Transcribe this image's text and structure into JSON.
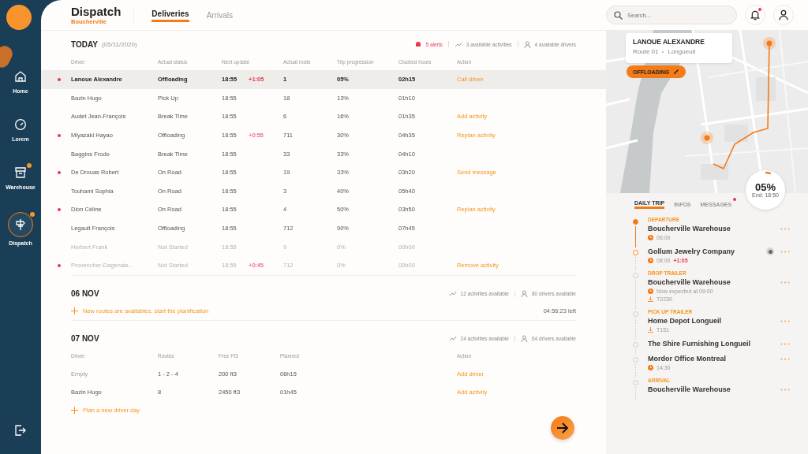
{
  "sidebar": {
    "items": [
      {
        "label": "Home",
        "selected": false,
        "badge": false
      },
      {
        "label": "Lorem",
        "selected": false,
        "badge": false
      },
      {
        "label": "Warehouse",
        "selected": false,
        "badge": true
      },
      {
        "label": "Dispatch",
        "selected": true,
        "badge": true
      }
    ]
  },
  "header": {
    "title": "Dispatch",
    "subtitle": "Boucherville",
    "tabs": [
      {
        "label": "Deliveries",
        "selected": true
      },
      {
        "label": "Arrivals",
        "selected": false
      }
    ]
  },
  "today": {
    "title": "TODAY",
    "date": "(05/11/2020)",
    "alerts": "5 alerts",
    "activities": "3 available activities",
    "drivers": "4 available drivers",
    "columns": [
      "Driver",
      "Actual status",
      "Next update",
      "Actual route",
      "Trip progression",
      "Clocked hours",
      "Action"
    ],
    "rows": [
      {
        "alert": true,
        "selected": true,
        "disabled": false,
        "driver": "Lanoue Alexandre",
        "status": "Offloading",
        "next_update": "18:55",
        "delay": "+1:05",
        "route": "1",
        "trip": "05%",
        "clocked": "02h15",
        "action": "Call driver"
      },
      {
        "alert": false,
        "selected": false,
        "disabled": false,
        "driver": "Bazin Hugo",
        "status": "Pick Up",
        "next_update": "18:55",
        "route": "18",
        "trip": "13%",
        "clocked": "01h10"
      },
      {
        "alert": false,
        "selected": false,
        "disabled": false,
        "driver": "Audet Jean-François",
        "status": "Break Time",
        "next_update": "18:55",
        "route": "6",
        "trip": "16%",
        "clocked": "01h35",
        "action": "Add activity"
      },
      {
        "alert": true,
        "selected": false,
        "disabled": false,
        "driver": "Miyazaki Hayao",
        "status": "Offloading",
        "next_update": "18:55",
        "delay": "+0:55",
        "route": "711",
        "trip": "30%",
        "clocked": "04h35",
        "action": "Replan activity"
      },
      {
        "alert": false,
        "selected": false,
        "disabled": false,
        "driver": "Baggins Frodo",
        "status": "Break Time",
        "next_update": "18:55",
        "route": "33",
        "trip": "33%",
        "clocked": "04h10"
      },
      {
        "alert": true,
        "selected": false,
        "disabled": false,
        "driver": "De Drouas Robert",
        "status": "On Road",
        "next_update": "18:55",
        "route": "19",
        "trip": "33%",
        "clocked": "03h20",
        "action": "Send message"
      },
      {
        "alert": false,
        "selected": false,
        "disabled": false,
        "driver": "Touhami Sophia",
        "status": "On Road",
        "next_update": "18:55",
        "route": "3",
        "trip": "40%",
        "clocked": "05h40"
      },
      {
        "alert": true,
        "selected": false,
        "disabled": false,
        "driver": "Dion Céline",
        "status": "On Road",
        "next_update": "18:55",
        "route": "4",
        "trip": "50%",
        "clocked": "03h50",
        "action": "Replan activity"
      },
      {
        "alert": false,
        "selected": false,
        "disabled": false,
        "driver": "Legault François",
        "status": "Offloading",
        "next_update": "18:55",
        "route": "712",
        "trip": "90%",
        "clocked": "07h45"
      },
      {
        "alert": false,
        "selected": false,
        "disabled": true,
        "driver": "Herbert Frank",
        "status": "Not Started",
        "next_update": "18:55",
        "route": "9",
        "trip": "0%",
        "clocked": "00h00"
      },
      {
        "alert": true,
        "selected": false,
        "disabled": true,
        "driver": "Provencher-Dagenais...",
        "status": "Not Started",
        "next_update": "18:55",
        "delay": "+0:45",
        "route": "712",
        "trip": "0%",
        "clocked": "00h00",
        "action": "Remove activity"
      }
    ]
  },
  "nov06": {
    "title": "06 NOV",
    "activities": "12 activities available",
    "drivers": "80 drivers available",
    "link": "New routes are availables, start the planification",
    "countdown": "04:56:23 left"
  },
  "nov07": {
    "title": "07 NOV",
    "activities": "24 activities available",
    "drivers": "64 drivers available",
    "columns": [
      "Driver",
      "Routes",
      "Free Ft3",
      "Planned",
      "Action"
    ],
    "rows": [
      {
        "driver": "Empty",
        "empty": true,
        "routes": "1 - 2 - 4",
        "free": "200 ft3",
        "planned": "06h15",
        "action": "Add driver"
      },
      {
        "driver": "Bazin Hugo",
        "empty": false,
        "routes": "8",
        "free": "2450 ft3",
        "planned": "01h45",
        "action": "Add activity"
      }
    ],
    "link": "Plan a new driver day"
  },
  "search": {
    "placeholder": "Search..."
  },
  "notifications": {
    "unread": true
  },
  "map_card": {
    "name": "LANOUE ALEXANDRE",
    "route": "Route 01",
    "city": "Longueuil",
    "status": "OFFLOADING"
  },
  "progress": {
    "percent": "05%",
    "end": "End: 18:50",
    "level": 0.05
  },
  "panel_tabs": [
    {
      "label": "DAILY TRIP",
      "selected": true,
      "dot": false
    },
    {
      "label": "INFOS",
      "selected": false,
      "dot": false
    },
    {
      "label": "MESSAGES",
      "selected": false,
      "dot": true
    }
  ],
  "stops": [
    {
      "category": "DEPARTURE",
      "name": "Boucherville Warehouse",
      "time": "06:00",
      "reached": true,
      "current": false,
      "contact": false
    },
    {
      "name": "Gollum Jewelry Company",
      "time": "08:00",
      "delay": "+1:05",
      "reached": false,
      "current": true,
      "contact": true
    },
    {
      "category": "DROP TRAILER",
      "name": "Boucherville Warehouse",
      "time": "Now expected at 09:00",
      "trailer": "T2230",
      "reached": false,
      "current": false,
      "contact": false
    },
    {
      "category": "PICK UP TRAILER",
      "name": "Home Depot Longueil",
      "trailer": "T151",
      "reached": false,
      "current": false,
      "contact": false
    },
    {
      "name": "The Shire Furnishing Longueil",
      "reached": false,
      "current": false,
      "contact": false
    },
    {
      "name": "Mordor Office Montreal",
      "time": "14:30",
      "reached": false,
      "current": false,
      "contact": false
    },
    {
      "category": "ARRIVAL",
      "name": "Boucherville Warehouse",
      "reached": false,
      "current": false,
      "contact": false
    }
  ]
}
